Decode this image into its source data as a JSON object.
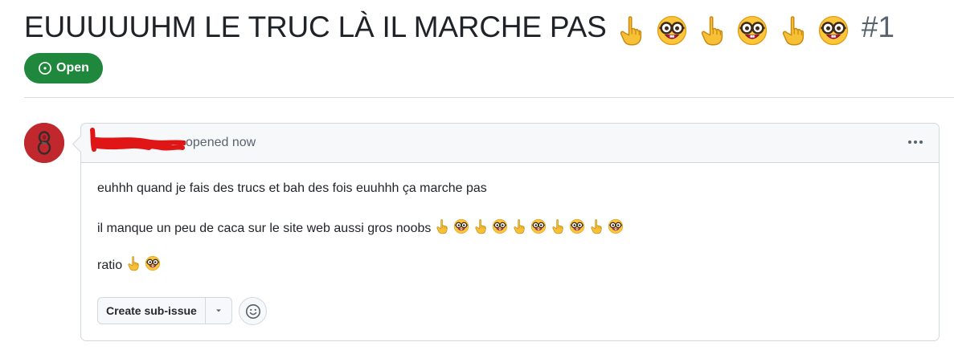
{
  "issue": {
    "title": "EUUUUUHM LE TRUC LÀ IL MARCHE PAS",
    "title_emojis": [
      "point-up-emoji",
      "nerd-face-emoji",
      "point-up-emoji",
      "nerd-face-emoji",
      "point-up-emoji",
      "nerd-face-emoji"
    ],
    "number": "#1",
    "state": {
      "label": "Open",
      "color": "#1f883d",
      "icon": "issue-opened-icon"
    }
  },
  "comment": {
    "author_redacted": true,
    "author_avatar_color": "#c0282e",
    "meta_text": "opened now",
    "menu_icon": "kebab-horizontal-icon",
    "body": [
      {
        "text": "euhhh quand je fais des trucs et bah des fois euuhhh ça marche pas"
      },
      {
        "text": "il manque un peu de caca sur le site web aussi gros noobs"
      },
      {
        "text": "ratio"
      }
    ],
    "actions": {
      "create_sub_issue_label": "Create sub-issue",
      "dropdown_icon": "triangle-down-icon",
      "reaction_icon": "smiley-icon"
    }
  },
  "colors": {
    "accent_green": "#1f883d",
    "border": "#d1d9e0",
    "header_bg": "#f6f8fa",
    "muted_text": "#59636e"
  }
}
